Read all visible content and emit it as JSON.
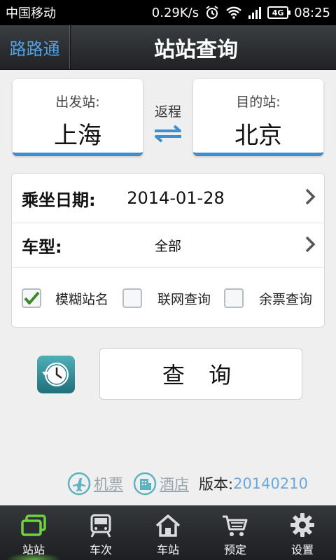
{
  "status_bar": {
    "carrier": "中国移动",
    "speed": "0.29K/s",
    "network": "4G",
    "time": "08:25"
  },
  "title_bar": {
    "app_name": "路路通",
    "title": "站站查询"
  },
  "stations": {
    "from_label": "出发站:",
    "from_value": "上海",
    "to_label": "目的站:",
    "to_value": "北京",
    "swap_label": "返程"
  },
  "options": {
    "date_label": "乘坐日期:",
    "date_value": "2014-01-28",
    "type_label": "车型:",
    "type_value": "全部",
    "checkboxes": [
      {
        "label": "模糊站名",
        "checked": true
      },
      {
        "label": "联网查询",
        "checked": false
      },
      {
        "label": "余票查询",
        "checked": false
      }
    ]
  },
  "query_button": "查 询",
  "footer": {
    "flight_link": "机票",
    "hotel_link": "酒店",
    "version_label": "版本:",
    "version_value": "20140210"
  },
  "bottom_nav": [
    {
      "label": "站站",
      "icon": "station-to-station-icon",
      "active": true
    },
    {
      "label": "车次",
      "icon": "train-icon",
      "active": false
    },
    {
      "label": "车站",
      "icon": "home-station-icon",
      "active": false
    },
    {
      "label": "预定",
      "icon": "cart-icon",
      "active": false
    },
    {
      "label": "设置",
      "icon": "gear-icon",
      "active": false
    }
  ],
  "colors": {
    "accent": "#3d8fd1",
    "app_name": "#4fa3e6",
    "version": "#6aa8e0",
    "check": "#3a8a2a"
  }
}
